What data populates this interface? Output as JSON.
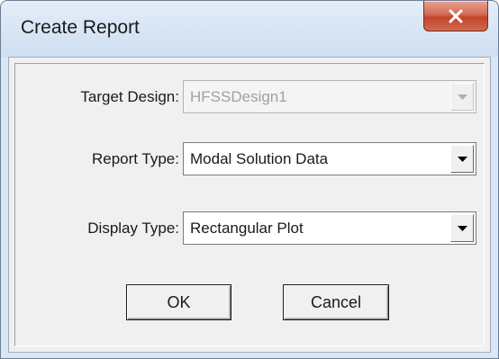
{
  "window": {
    "title": "Create Report",
    "close_icon": "close-x-icon"
  },
  "form": {
    "target_design": {
      "label": "Target Design:",
      "value": "HFSSDesign1",
      "enabled": false
    },
    "report_type": {
      "label": "Report Type:",
      "value": "Modal Solution Data"
    },
    "display_type": {
      "label": "Display Type:",
      "value": "Rectangular Plot"
    }
  },
  "buttons": {
    "ok": "OK",
    "cancel": "Cancel"
  },
  "colors": {
    "close_button": "#c9513a",
    "dialog_face": "#f0f0f0",
    "frame": "#d9e6f4"
  }
}
